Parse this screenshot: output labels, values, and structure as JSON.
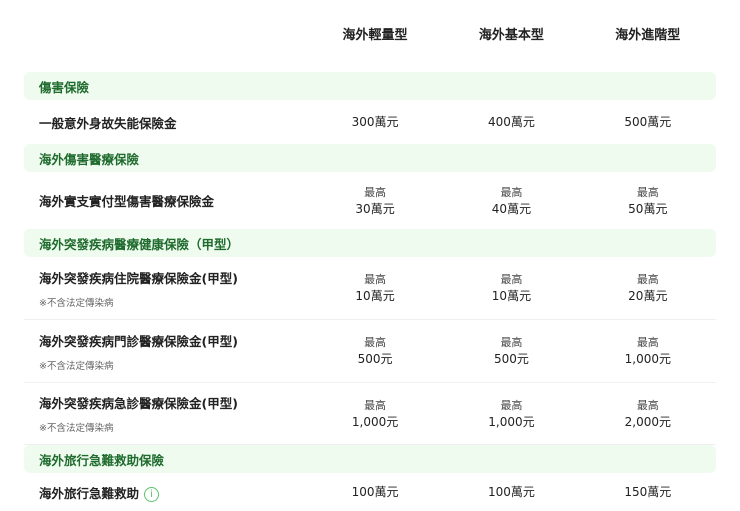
{
  "plans": [
    "海外輕量型",
    "海外基本型",
    "海外進階型"
  ],
  "max_label": "最高",
  "sections": [
    {
      "title": "傷害保險",
      "rows": [
        {
          "name": "一般意外身故失能保險金",
          "note": null,
          "prefix": false,
          "values": [
            "300萬元",
            "400萬元",
            "500萬元"
          ]
        }
      ]
    },
    {
      "title": "海外傷害醫療保險",
      "rows": [
        {
          "name": "海外實支實付型傷害醫療保險金",
          "note": null,
          "prefix": true,
          "values": [
            "30萬元",
            "40萬元",
            "50萬元"
          ]
        }
      ]
    },
    {
      "title": "海外突發疾病醫療健康保險（甲型）",
      "rows": [
        {
          "name": "海外突發疾病住院醫療保險金(甲型)",
          "note": "※不含法定傳染病",
          "prefix": true,
          "values": [
            "10萬元",
            "10萬元",
            "20萬元"
          ]
        },
        {
          "name": "海外突發疾病門診醫療保險金(甲型)",
          "note": "※不含法定傳染病",
          "prefix": true,
          "values": [
            "500元",
            "500元",
            "1,000元"
          ]
        },
        {
          "name": "海外突發疾病急診醫療保險金(甲型)",
          "note": "※不含法定傳染病",
          "prefix": true,
          "values": [
            "1,000元",
            "1,000元",
            "2,000元"
          ]
        }
      ]
    },
    {
      "title": "海外旅行急難救助保險",
      "rows": [
        {
          "name": "海外旅行急難救助",
          "note": null,
          "prefix": false,
          "info": "i",
          "values": [
            "100萬元",
            "100萬元",
            "150萬元"
          ]
        }
      ]
    }
  ]
}
